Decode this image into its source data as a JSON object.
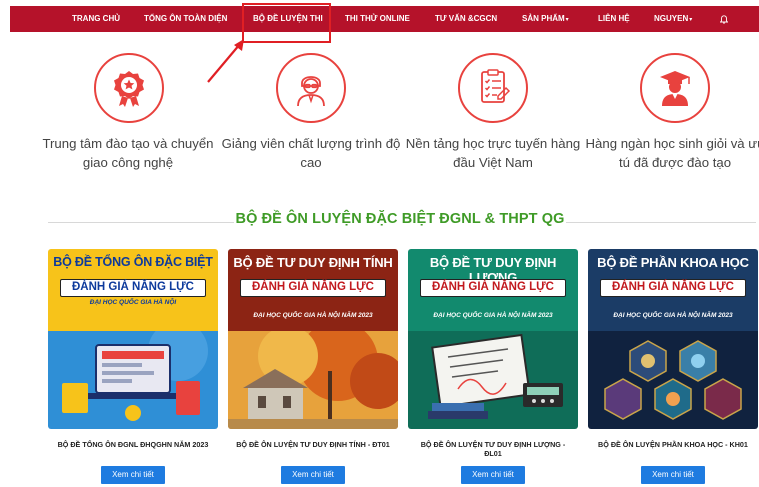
{
  "nav": {
    "items": [
      {
        "label": "TRANG CHỦ"
      },
      {
        "label": "TỔNG ÔN TOÀN DIỆN"
      },
      {
        "label": "BỘ ĐỀ LUYỆN THI"
      },
      {
        "label": "THI THỬ ONLINE"
      },
      {
        "label": "TƯ VẤN &CGCN"
      },
      {
        "label": "SẢN PHẨM"
      },
      {
        "label": "LIÊN HỆ"
      },
      {
        "label": "NGUYEN"
      }
    ]
  },
  "features": [
    {
      "icon": "award-medal-icon",
      "text": "Trung tâm đào tạo và chuyển giao công nghệ"
    },
    {
      "icon": "teacher-icon",
      "text": "Giảng viên chất lượng trình độ cao"
    },
    {
      "icon": "online-checklist-icon",
      "text": "Nền tảng học trực tuyến hàng đầu Việt Nam"
    },
    {
      "icon": "graduate-student-icon",
      "text": "Hàng ngàn học sinh giỏi và ưu tú đã được đào tạo"
    }
  ],
  "section": {
    "title": "BỘ ĐỀ ÔN LUYỆN ĐẶC BIỆT ĐGNL & THPT QG"
  },
  "cards": [
    {
      "heading": "BỘ ĐỀ TỔNG ÔN ĐẶC BIỆT",
      "pill": "ĐÁNH GIÁ NĂNG LỰC",
      "sub": "ĐẠI HỌC QUỐC GIA HÀ NỘI",
      "title": "BỘ ĐỀ TỔNG ÔN ĐGNL ĐHQGHN NĂM 2023",
      "button": "Xem chi tiết",
      "color": "#f7c31a"
    },
    {
      "heading": "BỘ ĐỀ TƯ DUY ĐỊNH TÍNH",
      "pill": "ĐÁNH GIÁ NĂNG LỰC",
      "sub": "ĐẠI HỌC QUỐC GIA HÀ NỘI NĂM 2023",
      "title": "BỘ ĐỀ ÔN LUYỆN TƯ DUY ĐỊNH TÍNH - ĐT01",
      "button": "Xem chi tiết",
      "color": "#8c2414"
    },
    {
      "heading": "BỘ ĐỀ TƯ DUY ĐỊNH LƯỢNG",
      "pill": "ĐÁNH GIÁ NĂNG LỰC",
      "sub": "ĐẠI HỌC QUỐC GIA HÀ NỘI NĂM 2023",
      "title": "BỘ ĐỀ ÔN LUYỆN TƯ DUY ĐỊNH LƯỢNG - ĐL01",
      "button": "Xem chi tiết",
      "color": "#128a6e"
    },
    {
      "heading": "BỘ ĐỀ PHẦN KHOA HỌC",
      "pill": "ĐÁNH GIÁ NĂNG LỰC",
      "sub": "ĐẠI HỌC QUỐC GIA HÀ NỘI NĂM 2023",
      "title": "BỘ ĐỀ ÔN LUYỆN PHẦN KHOA HỌC - KH01",
      "button": "Xem chi tiết",
      "color": "#1b3c66"
    }
  ],
  "colors": {
    "nav": "#b5122a",
    "accent": "#e8423e",
    "sectionTitle": "#3f9b27",
    "button": "#1e7be0"
  }
}
